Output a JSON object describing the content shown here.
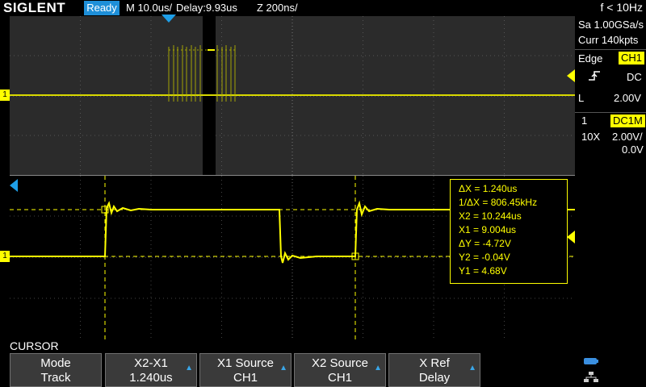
{
  "header": {
    "logo": "SIGLENT",
    "run_state": "Ready",
    "timebase": "M 10.0us/",
    "delay": "Delay:9.93us",
    "zoom": "Z 200ns/",
    "frequency": "f < 10Hz"
  },
  "acquisition": {
    "sample_rate": "Sa 1.00GSa/s",
    "memory": "Curr 140kpts"
  },
  "trigger": {
    "type": "Edge",
    "source": "CH1",
    "coupling": "DC",
    "level_label": "L",
    "level": "2.00V"
  },
  "channel": {
    "number": "1",
    "coupling": "DC1M",
    "probe": "10X",
    "scale": "2.00V/",
    "offset": "0.0V"
  },
  "markers": {
    "ch1": "1",
    "trigger_pos_icon": "down-triangle",
    "trigger_level_icon": "left-triangle"
  },
  "cursor_readout": {
    "delta_x": "ΔX = 1.240us",
    "inv_delta_x": "1/ΔX = 806.45kHz",
    "x2": "X2 = 10.244us",
    "x1": "X1 = 9.004us",
    "delta_y": "ΔY = -4.72V",
    "y2": "Y2 = -0.04V",
    "y1": "Y1 = 4.68V"
  },
  "menu": {
    "title": "CURSOR",
    "softkeys": [
      {
        "label": "Mode",
        "value": "Track"
      },
      {
        "label": "X2-X1",
        "value": "1.240us"
      },
      {
        "label": "X1 Source",
        "value": "CH1"
      },
      {
        "label": "X2 Source",
        "value": "CH1"
      },
      {
        "label": "X Ref",
        "value": "Delay"
      }
    ]
  },
  "colors": {
    "channel1": "#ffff00",
    "accent": "#1e8fd8",
    "grid": "#555555"
  }
}
